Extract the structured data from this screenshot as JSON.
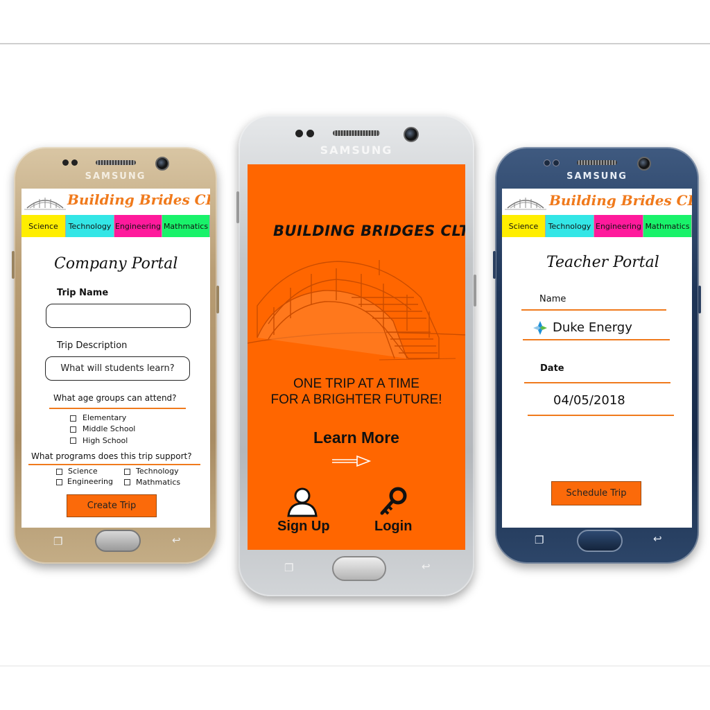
{
  "brand": "SAMSUNG",
  "app": {
    "logo_title": "Building Brides CLT",
    "categories": [
      {
        "label": "Science",
        "color": "#ffee00"
      },
      {
        "label": "Technology",
        "color": "#33e6e6"
      },
      {
        "label": "Engineering",
        "color": "#ff1a9c"
      },
      {
        "label": "Mathmatics",
        "color": "#19f26a"
      }
    ]
  },
  "company_portal": {
    "title": "Company Portal",
    "trip_name_label": "Trip Name",
    "trip_name_value": "",
    "trip_description_label": "Trip Description",
    "trip_description_placeholder": "What will students learn?",
    "age_question": "What age groups can attend?",
    "age_groups": [
      "Elementary",
      "Middle School",
      "High School"
    ],
    "programs_question": "What programs does this trip support?",
    "programs": [
      "Science",
      "Technology",
      "Engineering",
      "Mathmatics"
    ],
    "create_button": "Create Trip"
  },
  "landing": {
    "title": "BUILDING BRIDGES CLT",
    "tagline_line1": "ONE TRIP AT A TIME",
    "tagline_line2": "FOR A BRIGHTER FUTURE!",
    "learn_more": "Learn More",
    "sign_up": "Sign Up",
    "login": "Login",
    "background_color": "#ff6600"
  },
  "teacher_portal": {
    "title": "Teacher Portal",
    "name_label": "Name",
    "name_value": "Duke Energy",
    "date_label": "Date",
    "date_value": "04/05/2018",
    "schedule_button": "Schedule Trip"
  },
  "colors": {
    "accent_orange": "#f07a1c",
    "button_orange": "#fb6a0a"
  },
  "icons": [
    "bridge-logo-icon",
    "bridge-illustration-icon",
    "arrow-right-icon",
    "user-icon",
    "key-icon",
    "duke-energy-logo-icon",
    "recents-icon",
    "back-icon"
  ]
}
